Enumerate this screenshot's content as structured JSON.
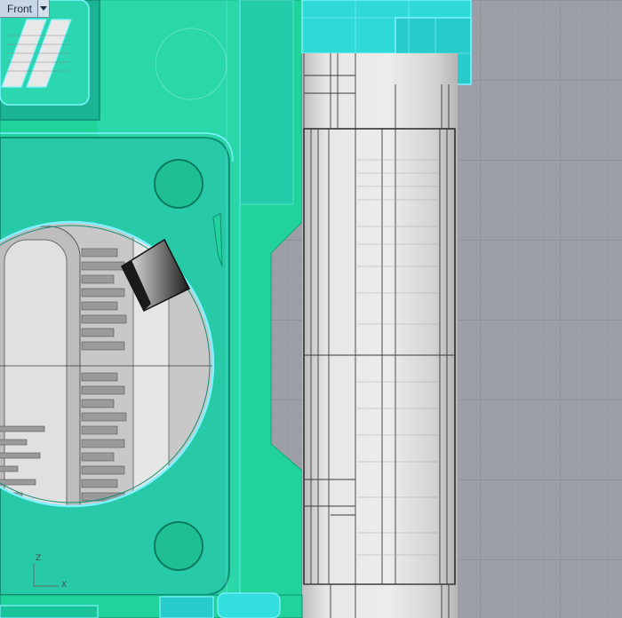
{
  "viewport": {
    "title": "Front",
    "menu_icon": "chevron-down-icon"
  },
  "axes": {
    "z_label": "Z",
    "x_label": "X"
  },
  "colors": {
    "background_grid": "#9a9ea4",
    "grid_line": "#8c9096",
    "grid_major": "#7e8288",
    "part_green": "#1fd39a",
    "part_cyan": "#2fd9d6",
    "selection_edge": "#7ff2ff",
    "shaded_gray": "#d9d9d9",
    "wire_dark": "#2a2a2a"
  }
}
